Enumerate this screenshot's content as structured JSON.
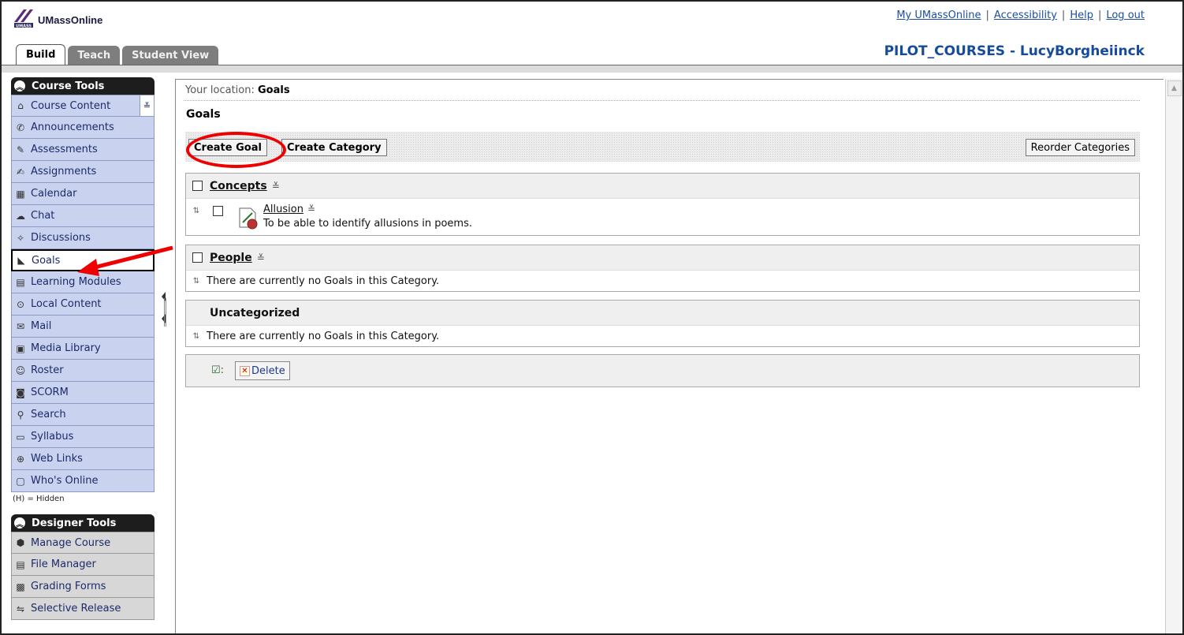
{
  "header": {
    "logo_text": "UMassOnline",
    "links": [
      "My UMassOnline",
      "Accessibility",
      "Help",
      "Log out"
    ],
    "course_title": "PILOT_COURSES - LucyBorgheiinck",
    "tabs": [
      {
        "label": "Build",
        "active": true
      },
      {
        "label": "Teach",
        "active": false
      },
      {
        "label": "Student View",
        "active": false
      }
    ]
  },
  "sidebar": {
    "course_tools_title": "Course Tools",
    "course_tools": [
      {
        "label": "Course Content",
        "icon": "home-icon"
      },
      {
        "label": "Announcements",
        "icon": "megaphone-icon"
      },
      {
        "label": "Assessments",
        "icon": "assessment-icon"
      },
      {
        "label": "Assignments",
        "icon": "assignment-icon"
      },
      {
        "label": "Calendar",
        "icon": "calendar-icon"
      },
      {
        "label": "Chat",
        "icon": "chat-icon"
      },
      {
        "label": "Discussions",
        "icon": "discussion-icon"
      },
      {
        "label": "Goals",
        "icon": "goals-icon",
        "selected": true
      },
      {
        "label": "Learning Modules",
        "icon": "module-icon"
      },
      {
        "label": "Local Content",
        "icon": "local-content-icon"
      },
      {
        "label": "Mail",
        "icon": "mail-icon"
      },
      {
        "label": "Media Library",
        "icon": "media-icon"
      },
      {
        "label": "Roster",
        "icon": "roster-icon"
      },
      {
        "label": "SCORM",
        "icon": "scorm-icon"
      },
      {
        "label": "Search",
        "icon": "search-icon"
      },
      {
        "label": "Syllabus",
        "icon": "syllabus-icon"
      },
      {
        "label": "Web Links",
        "icon": "weblinks-icon"
      },
      {
        "label": "Who's Online",
        "icon": "whos-online-icon"
      }
    ],
    "hidden_note": "(H) = Hidden",
    "designer_tools_title": "Designer Tools",
    "designer_tools": [
      {
        "label": "Manage Course",
        "icon": "manage-course-icon"
      },
      {
        "label": "File Manager",
        "icon": "file-manager-icon"
      },
      {
        "label": "Grading Forms",
        "icon": "grading-forms-icon"
      },
      {
        "label": "Selective Release",
        "icon": "selective-release-icon"
      }
    ]
  },
  "main": {
    "location_label": "Your location:",
    "location_value": "Goals",
    "page_title": "Goals",
    "buttons": {
      "create_goal": "Create Goal",
      "create_category": "Create Category",
      "reorder_categories": "Reorder Categories"
    },
    "categories": [
      {
        "name": "Concepts",
        "goals": [
          {
            "title": "Allusion",
            "description": "To be able to identify allusions in poems."
          }
        ]
      },
      {
        "name": "People",
        "empty_message": "There are currently no Goals in this Category."
      },
      {
        "name": "Uncategorized",
        "empty_message": "There are currently no Goals in this Category."
      }
    ],
    "delete_label": "Delete"
  }
}
